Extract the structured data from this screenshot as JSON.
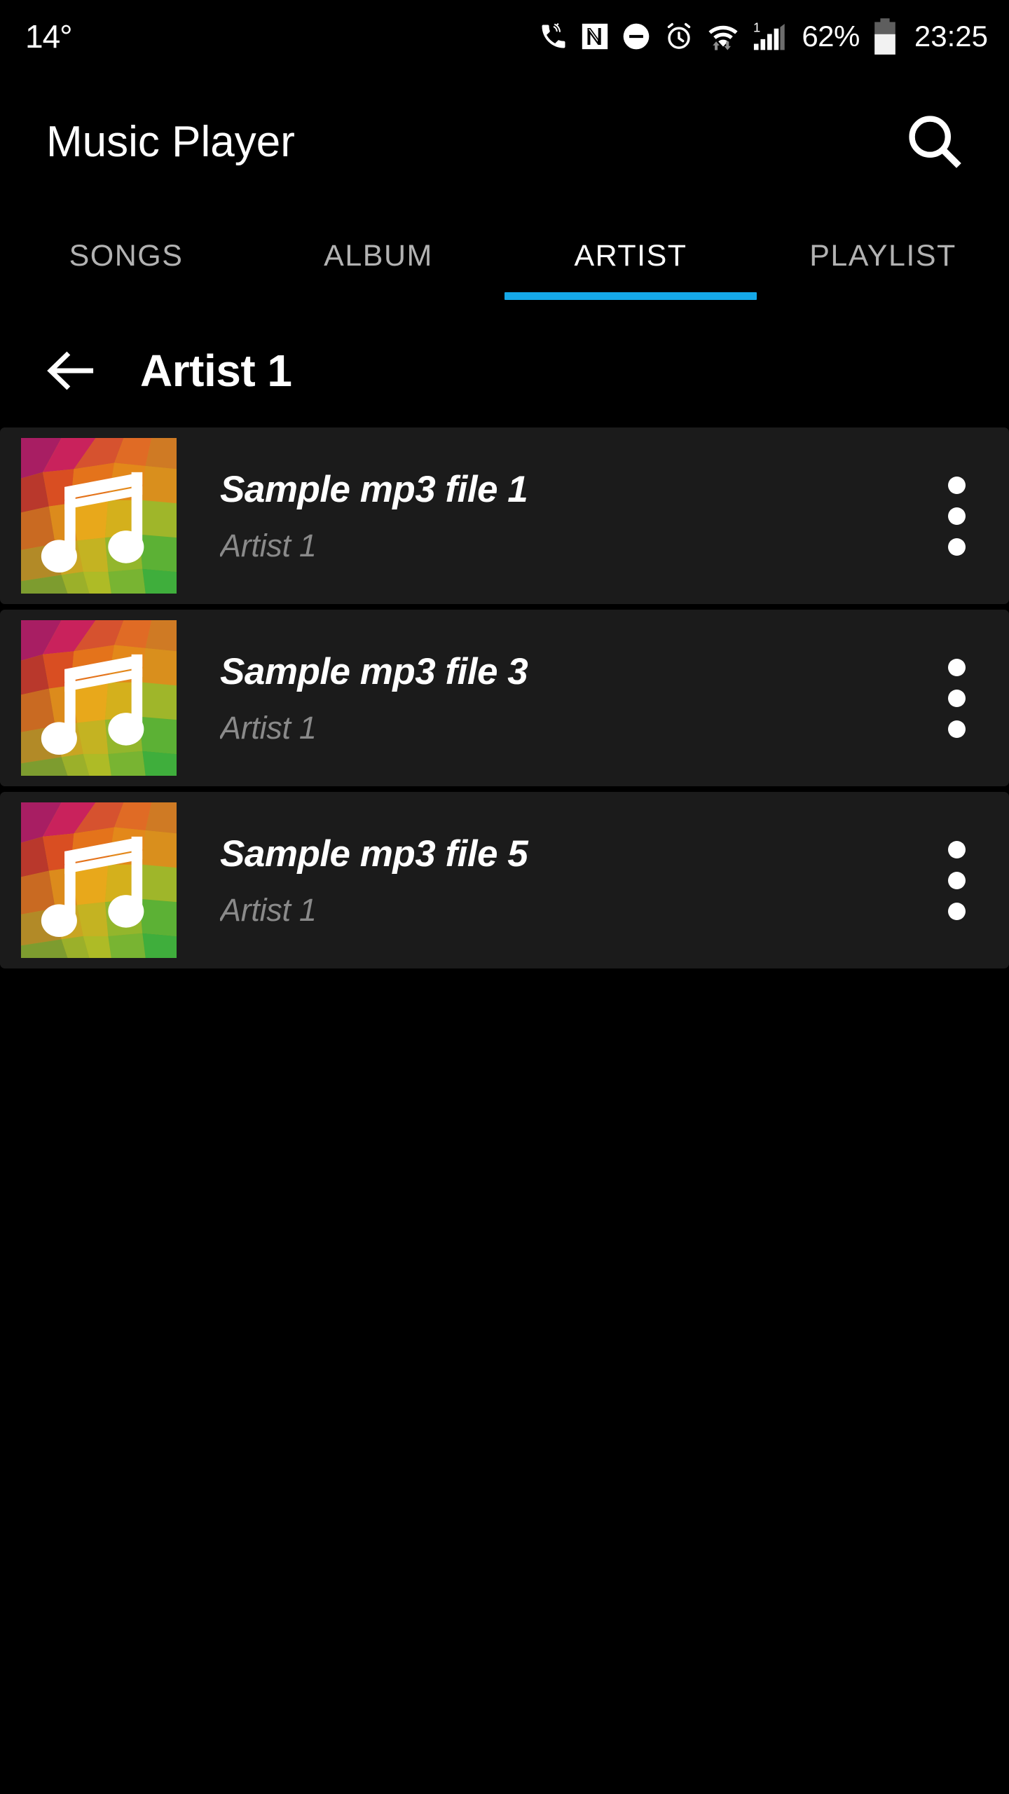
{
  "status_bar": {
    "temperature": "14°",
    "battery_percent": "62%",
    "clock": "23:25",
    "sim_index": "1",
    "icons": [
      "call-ringer-icon",
      "nfc-icon",
      "do-not-disturb-icon",
      "alarm-clock-icon",
      "wifi-data-icon",
      "cellular-signal-icon",
      "battery-icon"
    ]
  },
  "app_bar": {
    "title": "Music Player",
    "search_icon": "search-icon"
  },
  "tabs": {
    "active_index": 2,
    "indicator_color": "#15a8e8",
    "items": [
      {
        "label": "SONGS"
      },
      {
        "label": "ALBUM"
      },
      {
        "label": "ARTIST"
      },
      {
        "label": "PLAYLIST"
      }
    ]
  },
  "artist_header": {
    "back_icon": "back-arrow-icon",
    "name": "Artist 1"
  },
  "song_list": {
    "rows": [
      {
        "title": "Sample mp3 file 1",
        "artist": "Artist 1",
        "art": "music-note-album-art",
        "overflow": "overflow-menu-icon"
      },
      {
        "title": "Sample mp3 file 3",
        "artist": "Artist 1",
        "art": "music-note-album-art",
        "overflow": "overflow-menu-icon"
      },
      {
        "title": "Sample mp3 file 5",
        "artist": "Artist 1",
        "art": "music-note-album-art",
        "overflow": "overflow-menu-icon"
      }
    ]
  },
  "colors": {
    "background": "#000000",
    "row_background": "#1b1b1b",
    "accent": "#15a8e8",
    "title_text": "#ffffff",
    "subtitle_text": "#8a8a8a",
    "tab_inactive": "#b2b2b2"
  }
}
